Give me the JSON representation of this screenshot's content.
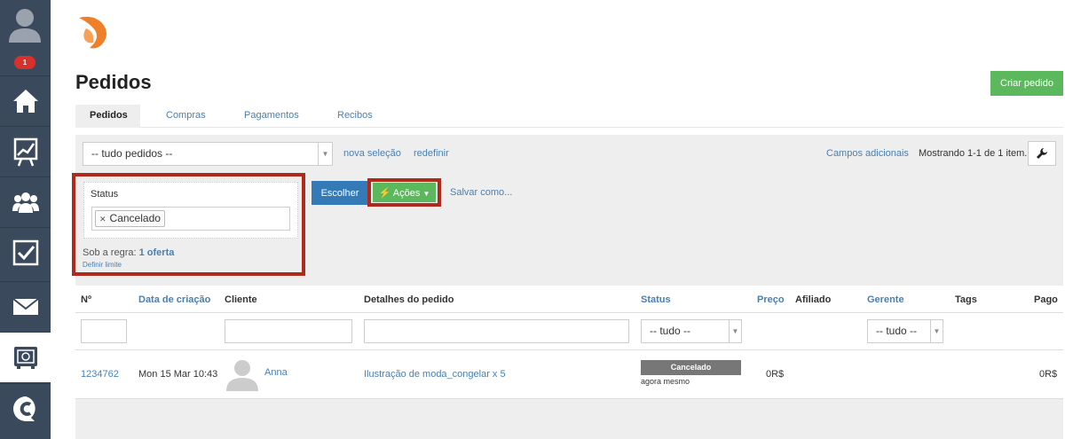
{
  "sidebar": {
    "badge_count": "1",
    "items": [
      {
        "icon": "home-icon"
      },
      {
        "icon": "chart-icon"
      },
      {
        "icon": "users-icon"
      },
      {
        "icon": "checkbox-icon"
      },
      {
        "icon": "mail-icon"
      },
      {
        "icon": "safe-icon"
      },
      {
        "icon": "chat-logo-icon"
      }
    ]
  },
  "header": {
    "title": "Pedidos",
    "create_button": "Criar pedido"
  },
  "tabs": [
    "Pedidos",
    "Compras",
    "Pagamentos",
    "Recibos"
  ],
  "filters": {
    "selection_value": "-- tudo pedidos --",
    "new_selection": "nova seleção",
    "reset": "redefinir",
    "additional_fields": "Campos adicionais",
    "showing": "Mostrando 1-1 de 1 item.",
    "status_label": "Status",
    "status_tag": "Cancelado",
    "rule_prefix": "Sob a regra:",
    "rule_value": "1 oferta",
    "define_limit": "Definir limite",
    "choose_button": "Escolher",
    "actions_button": "Ações",
    "save_as": "Salvar como..."
  },
  "table": {
    "columns": [
      "Nº",
      "Data de criação",
      "Cliente",
      "Detalhes do pedido",
      "Status",
      "Preço",
      "Afiliado",
      "Gerente",
      "Tags",
      "Pago"
    ],
    "filter_status": "-- tudo --",
    "filter_manager": "-- tudo --",
    "rows": [
      {
        "number": "1234762",
        "created": "Mon 15 Mar 10:43",
        "client": "Anna",
        "details": "Ilustração de moda_congelar x 5",
        "status": "Cancelado",
        "status_time": "agora mesmo",
        "price": "0R$",
        "paid": "0R$"
      }
    ]
  },
  "colors": {
    "sidebar": "#3a4a5c",
    "green": "#5cb85c",
    "blue": "#337ab7",
    "highlight": "#b02a1c",
    "badge": "#d9302c"
  }
}
